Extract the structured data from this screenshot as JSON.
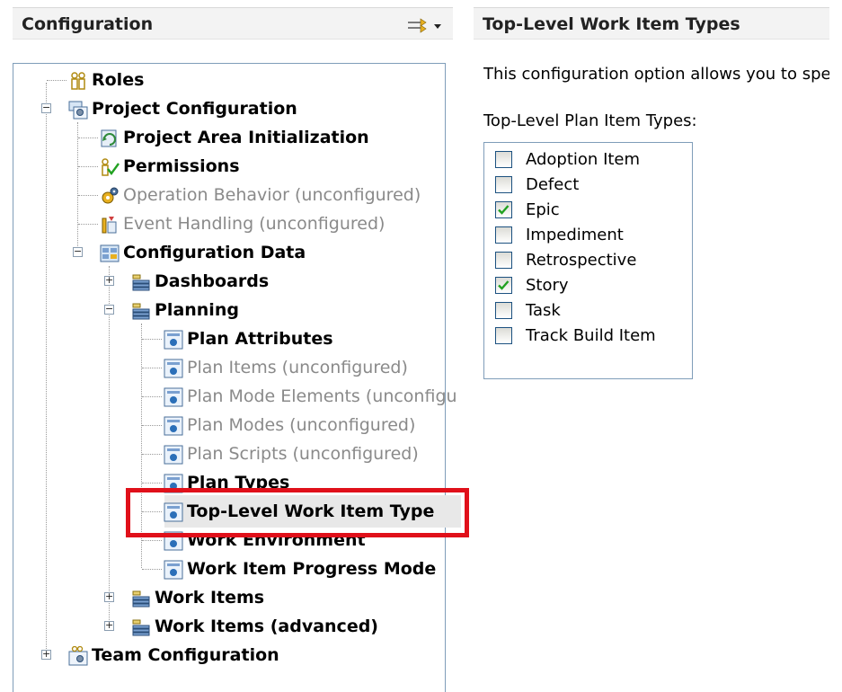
{
  "left_panel": {
    "title": "Configuration",
    "tree": [
      {
        "label": "Roles",
        "icon": "roles-icon",
        "style": "bold"
      },
      {
        "label": "Project Configuration",
        "icon": "project-config-icon",
        "style": "bold"
      },
      {
        "label": "Project Area Initialization",
        "icon": "initialization-icon",
        "style": "bold"
      },
      {
        "label": "Permissions",
        "icon": "permissions-icon",
        "style": "bold"
      },
      {
        "label": "Operation Behavior (unconfigured)",
        "icon": "gear-icon",
        "style": "gray"
      },
      {
        "label": "Event Handling (unconfigured)",
        "icon": "event-icon",
        "style": "gray"
      },
      {
        "label": "Configuration Data",
        "icon": "config-data-icon",
        "style": "bold"
      },
      {
        "label": "Dashboards",
        "icon": "folder-list-icon",
        "style": "bold"
      },
      {
        "label": "Planning",
        "icon": "folder-list-icon",
        "style": "bold"
      },
      {
        "label": "Plan Attributes",
        "icon": "plan-item-icon",
        "style": "bold"
      },
      {
        "label": "Plan Items (unconfigured)",
        "icon": "plan-item-icon",
        "style": "gray"
      },
      {
        "label": "Plan Mode Elements (unconfigu",
        "icon": "plan-item-icon",
        "style": "gray"
      },
      {
        "label": "Plan Modes (unconfigured)",
        "icon": "plan-item-icon",
        "style": "gray"
      },
      {
        "label": "Plan Scripts (unconfigured)",
        "icon": "plan-item-icon",
        "style": "gray"
      },
      {
        "label": "Plan Types",
        "icon": "plan-item-icon",
        "style": "bold"
      },
      {
        "label": "Top-Level Work Item Type",
        "icon": "plan-item-icon",
        "style": "bold"
      },
      {
        "label": "Work Environment",
        "icon": "plan-item-icon",
        "style": "bold"
      },
      {
        "label": "Work Item Progress Mode",
        "icon": "plan-item-icon",
        "style": "bold"
      },
      {
        "label": "Work Items",
        "icon": "folder-list-icon",
        "style": "bold"
      },
      {
        "label": "Work Items (advanced)",
        "icon": "folder-list-icon",
        "style": "bold"
      },
      {
        "label": "Team Configuration",
        "icon": "team-config-icon",
        "style": "bold"
      }
    ]
  },
  "right_panel": {
    "title": "Top-Level Work Item Types",
    "description": "This configuration option allows you to spe",
    "list_label": "Top-Level Plan Item Types:",
    "items": [
      {
        "label": "Adoption Item",
        "checked": false
      },
      {
        "label": "Defect",
        "checked": false
      },
      {
        "label": "Epic",
        "checked": true
      },
      {
        "label": "Impediment",
        "checked": false
      },
      {
        "label": "Retrospective",
        "checked": false
      },
      {
        "label": "Story",
        "checked": true
      },
      {
        "label": "Task",
        "checked": false
      },
      {
        "label": "Track Build Item",
        "checked": false
      }
    ]
  },
  "colors": {
    "highlight": "#e0101a",
    "border": "#7f9db9",
    "check": "#21a121"
  }
}
